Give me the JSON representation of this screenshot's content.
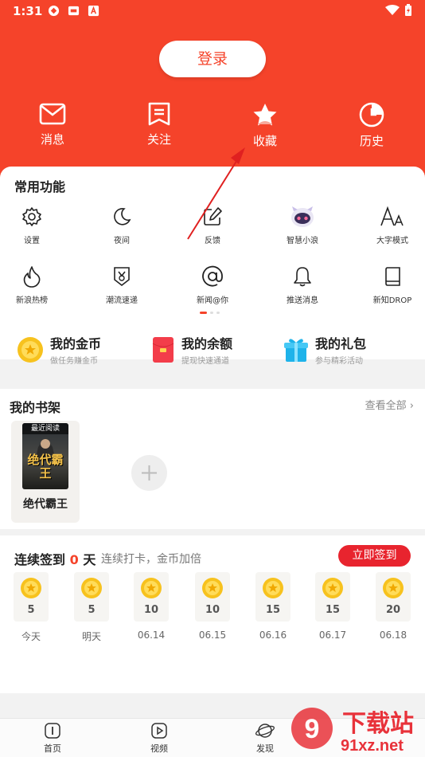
{
  "status": {
    "time": "1:31"
  },
  "header": {
    "login_label": "登录",
    "quick": [
      {
        "label": "消息",
        "icon": "mail-icon"
      },
      {
        "label": "关注",
        "icon": "bookmark-icon"
      },
      {
        "label": "收藏",
        "icon": "star-icon"
      },
      {
        "label": "历史",
        "icon": "clock-icon"
      }
    ]
  },
  "functions": {
    "title": "常用功能",
    "items": [
      {
        "label": "设置",
        "icon": "gear-icon"
      },
      {
        "label": "夜间",
        "icon": "moon-icon"
      },
      {
        "label": "反馈",
        "icon": "edit-icon"
      },
      {
        "label": "智慧小浪",
        "icon": "assistant-icon"
      },
      {
        "label": "大字模式",
        "icon": "font-size-icon"
      },
      {
        "label": "新浪热榜",
        "icon": "flame-icon"
      },
      {
        "label": "潮流速递",
        "icon": "badge-icon"
      },
      {
        "label": "新闻@你",
        "icon": "at-icon"
      },
      {
        "label": "推送消息",
        "icon": "bell-icon"
      },
      {
        "label": "新知DROP",
        "icon": "book-icon"
      }
    ]
  },
  "wallet": [
    {
      "title": "我的金币",
      "sub": "做任务赚金币",
      "icon": "coin-icon"
    },
    {
      "title": "我的余额",
      "sub": "提现快速通道",
      "icon": "red-envelope-icon"
    },
    {
      "title": "我的礼包",
      "sub": "参与精彩活动",
      "icon": "gift-icon"
    }
  ],
  "shelf": {
    "title": "我的书架",
    "more": "查看全部",
    "book": {
      "badge": "最近阅读",
      "cover_text": "绝代霸王",
      "name": "绝代霸王"
    }
  },
  "checkin": {
    "title_prefix": "连续签到",
    "days_count": "0",
    "title_suffix": "天",
    "subtitle": "连续打卡，金币加倍",
    "button": "立即签到",
    "days": [
      {
        "value": "5",
        "label": "今天"
      },
      {
        "value": "5",
        "label": "明天"
      },
      {
        "value": "10",
        "label": "06.14"
      },
      {
        "value": "10",
        "label": "06.15"
      },
      {
        "value": "15",
        "label": "06.16"
      },
      {
        "value": "15",
        "label": "06.17"
      },
      {
        "value": "20",
        "label": "06.18"
      }
    ]
  },
  "nav": [
    {
      "label": "首页",
      "icon": "home-icon"
    },
    {
      "label": "视频",
      "icon": "video-icon"
    },
    {
      "label": "发现",
      "icon": "planet-icon"
    }
  ],
  "watermark": {
    "text": "下载站",
    "site": "91xz.net"
  },
  "colors": {
    "brand": "#f5432a",
    "checkin_button": "#e8242e",
    "coin": "#f7c21e"
  }
}
